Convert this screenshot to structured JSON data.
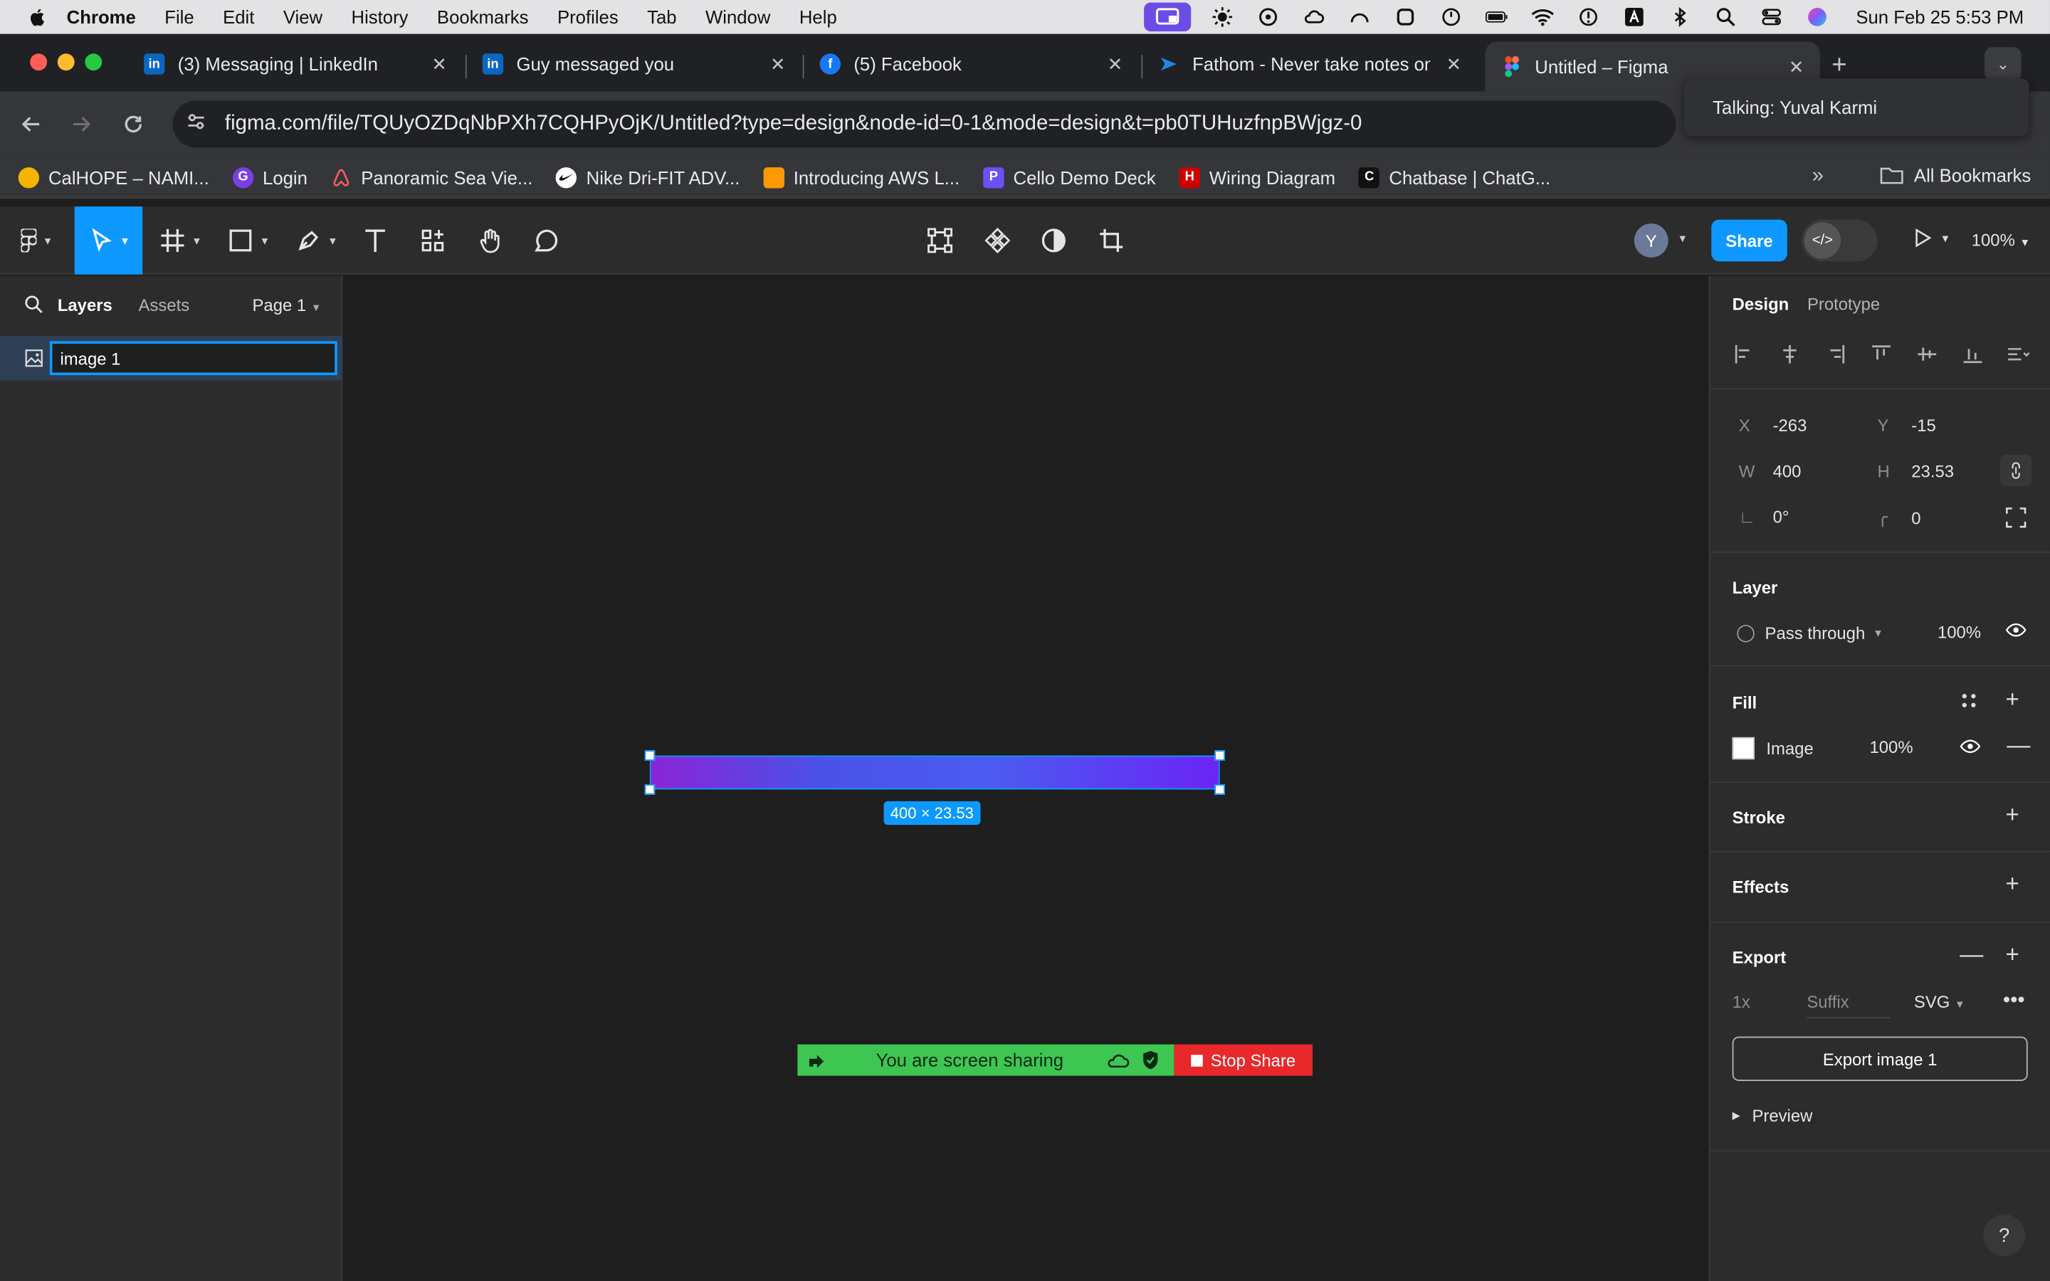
{
  "menubar": {
    "app": "Chrome",
    "items": [
      "File",
      "Edit",
      "View",
      "History",
      "Bookmarks",
      "Profiles",
      "Tab",
      "Window",
      "Help"
    ],
    "clock": "Sun Feb 25  5:53 PM"
  },
  "tabs": [
    {
      "title": "(3) Messaging | LinkedIn",
      "icon": "linkedin-icon",
      "color": "#0a66c2",
      "glyph": "in"
    },
    {
      "title": "Guy messaged you",
      "icon": "linkedin-icon",
      "color": "#0a66c2",
      "glyph": "in"
    },
    {
      "title": "(5) Facebook",
      "icon": "facebook-icon",
      "color": "#1877f2",
      "glyph": "f"
    },
    {
      "title": "Fathom - Never take notes on",
      "icon": "fathom-icon",
      "color": "#1e88e5",
      "glyph": ""
    },
    {
      "title": "Untitled – Figma",
      "icon": "figma-icon",
      "color": "#f24e1e",
      "glyph": ""
    }
  ],
  "address": {
    "url": "figma.com/file/TQUyOZDqNbPXh7CQHPyOjK/Untitled?type=design&node-id=0-1&mode=design&t=pb0TUHuzfnpBWjgz-0"
  },
  "talking_popup": "Talking: Yuval Karmi",
  "bookmarks": [
    {
      "label": "CalHOPE – NAMI...",
      "color": "#f4b400",
      "glyph": ""
    },
    {
      "label": "Login",
      "color": "#7b3fe4",
      "glyph": "G"
    },
    {
      "label": "Panoramic Sea Vie...",
      "color": "#ff5a5f",
      "glyph": ""
    },
    {
      "label": "Nike Dri-FIT ADV...",
      "color": "#ffffff",
      "glyph": ""
    },
    {
      "label": "Introducing AWS L...",
      "color": "#ff9900",
      "glyph": ""
    },
    {
      "label": "Cello Demo Deck",
      "color": "#6e4ff5",
      "glyph": "P"
    },
    {
      "label": "Wiring Diagram",
      "color": "#cc0000",
      "glyph": "H"
    },
    {
      "label": "Chatbase | ChatG...",
      "color": "#111111",
      "glyph": "C"
    }
  ],
  "all_bookmarks": "All Bookmarks",
  "figma": {
    "share_label": "Share",
    "avatar_initial": "Y",
    "zoom": "100%",
    "left": {
      "tab_layers": "Layers",
      "tab_assets": "Assets",
      "page": "Page 1",
      "layer_name": "image 1"
    },
    "canvas": {
      "size_badge": "400 × 23.53",
      "sharing_text": "You are screen sharing",
      "stop_share": "Stop Share"
    },
    "right": {
      "tab_design": "Design",
      "tab_prototype": "Prototype",
      "x": "-263",
      "y": "-15",
      "w": "400",
      "h": "23.53",
      "rotation": "0°",
      "radius": "0",
      "layer_title": "Layer",
      "blend": "Pass through",
      "opacity": "100%",
      "fill_title": "Fill",
      "fill_type": "Image",
      "fill_opacity": "100%",
      "stroke_title": "Stroke",
      "effects_title": "Effects",
      "export_title": "Export",
      "export_scale": "1x",
      "export_suffix": "Suffix",
      "export_format": "SVG",
      "export_button": "Export image 1",
      "preview": "Preview"
    }
  }
}
